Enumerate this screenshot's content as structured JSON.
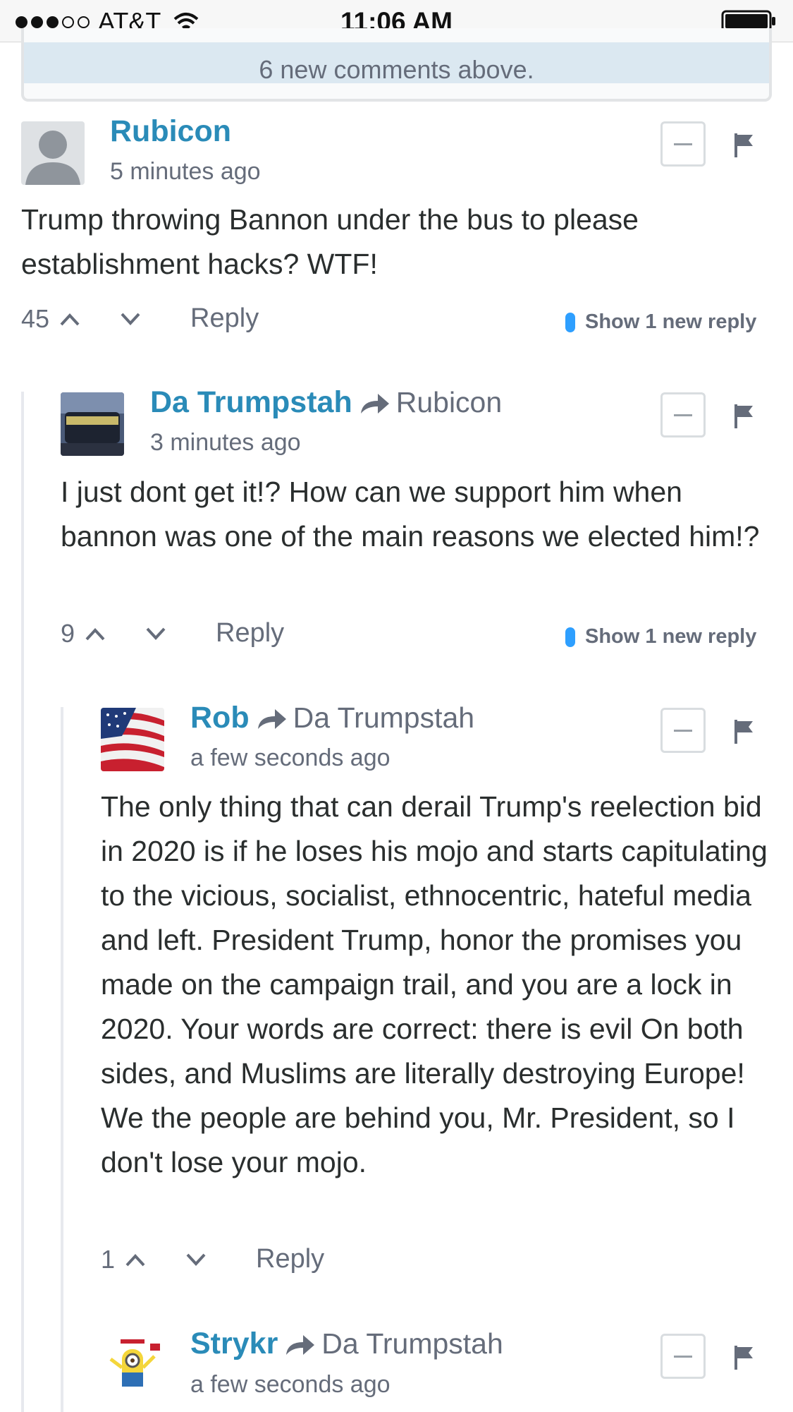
{
  "status_bar": {
    "carrier": "AT&T",
    "time": "11:06 AM"
  },
  "banner": {
    "text": "6 new comments above."
  },
  "comments": [
    {
      "author": "Rubicon",
      "reply_to": "",
      "time": "5 minutes ago",
      "body": "Trump throwing Bannon under the bus to please establishment hacks? WTF!",
      "score": "45",
      "reply_label": "Reply",
      "show_replies": "Show 1 new reply"
    },
    {
      "author": "Da Trumpstah",
      "reply_to": "Rubicon",
      "time": "3 minutes ago",
      "body": "I just dont get it!? How can we support him when bannon was one of the main reasons we elected him!?",
      "score": "9",
      "reply_label": "Reply",
      "show_replies": "Show 1 new reply",
      "avatar_text": "DRAIN THE SWAMP"
    },
    {
      "author": "Rob",
      "reply_to": "Da Trumpstah",
      "time": "a few seconds ago",
      "body": "The only thing that can derail Trump's reelection bid in 2020 is if he loses his mojo and starts capitulating to the vicious, socialist, ethnocentric, hateful media and left. President Trump, honor the promises you made on the campaign trail, and you are a lock in 2020. Your words are correct: there is evil On both sides, and Muslims are literally destroying Europe! We the people are behind you, Mr. President, so I don't lose your mojo.",
      "score": "1",
      "reply_label": "Reply"
    },
    {
      "author": "Strykr",
      "reply_to": "Da Trumpstah",
      "time": "a few seconds ago"
    }
  ],
  "colors": {
    "author": "#2a8bb8",
    "muted": "#656c7a",
    "accent_blue": "#2e9fff",
    "banner_bg": "#dbe8f1"
  },
  "icons": [
    "signal-dots-icon",
    "wifi-icon",
    "battery-icon",
    "reply-arrow-icon",
    "upvote-icon",
    "downvote-icon",
    "collapse-icon",
    "flag-icon"
  ]
}
